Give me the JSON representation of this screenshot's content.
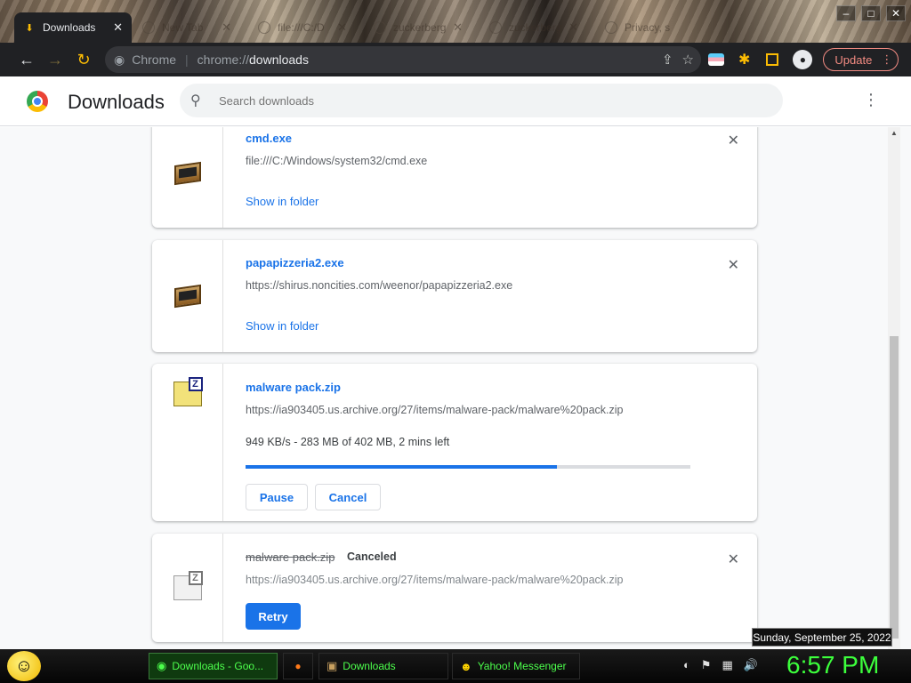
{
  "tabs": [
    {
      "label": "Downloads",
      "icon": "download-icon",
      "active": true
    },
    {
      "label": "New Tab",
      "icon": "chrome-icon",
      "active": false
    },
    {
      "label": "file:///C:/D",
      "icon": "file-icon",
      "active": false
    },
    {
      "label": "zuckerberg",
      "icon": "globe-icon",
      "active": false
    },
    {
      "label": "zuckerberg",
      "icon": "globe-icon",
      "active": false
    },
    {
      "label": "Privacy, s",
      "icon": "globe-icon",
      "active": false
    }
  ],
  "toolbar": {
    "chip": "Chrome",
    "url_prefix": "chrome://",
    "url_host": "downloads",
    "update_label": "Update"
  },
  "page": {
    "title": "Downloads",
    "search_placeholder": "Search downloads"
  },
  "downloads": [
    {
      "name": "cmd.exe",
      "url": "file:///C:/Windows/system32/cmd.exe",
      "action": "Show in folder",
      "icon": "exe-icon"
    },
    {
      "name": "papapizzeria2.exe",
      "url": "https://shirus.noncities.com/weenor/papapizzeria2.exe",
      "action": "Show in folder",
      "icon": "exe-icon"
    },
    {
      "name": "malware pack.zip",
      "url": "https://ia903405.us.archive.org/27/items/malware-pack/malware%20pack.zip",
      "status": "949 KB/s - 283 MB of 402 MB, 2 mins left",
      "progress": 0.7,
      "pause_label": "Pause",
      "cancel_label": "Cancel",
      "icon": "zip-icon"
    },
    {
      "name": "malware pack.zip",
      "state": "Canceled",
      "url": "https://ia903405.us.archive.org/27/items/malware-pack/malware%20pack.zip",
      "retry_label": "Retry",
      "icon": "zip-icon"
    }
  ],
  "taskbar": {
    "items": [
      {
        "label": "Downloads - Goo...",
        "icon": "chrome-icon"
      },
      {
        "label": "",
        "icon": "firefox-icon"
      },
      {
        "label": "Downloads",
        "icon": "folder-icon"
      },
      {
        "label": "Yahoo! Messenger",
        "icon": "smiley-icon"
      }
    ],
    "clock": "6:57 PM",
    "date_tooltip": "Sunday, September 25, 2022"
  }
}
